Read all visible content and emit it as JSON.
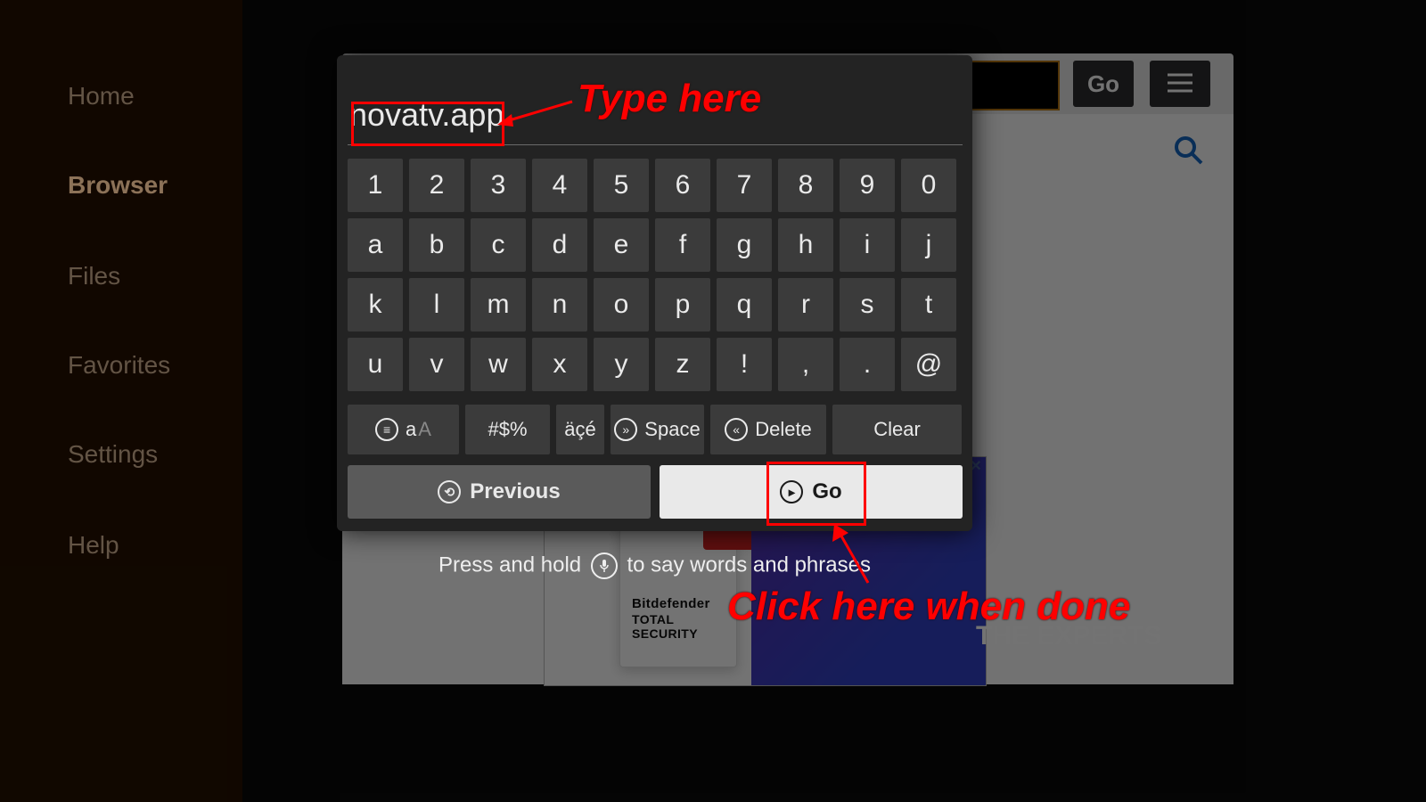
{
  "sidenav": {
    "items": [
      {
        "label": "Home"
      },
      {
        "label": "Browser"
      },
      {
        "label": "Files"
      },
      {
        "label": "Favorites"
      },
      {
        "label": "Settings"
      },
      {
        "label": "Help"
      }
    ],
    "active_index": 1
  },
  "toolbar": {
    "go_label": "Go"
  },
  "keyboard": {
    "input_value": "novatv.app",
    "rows": [
      [
        "1",
        "2",
        "3",
        "4",
        "5",
        "6",
        "7",
        "8",
        "9",
        "0"
      ],
      [
        "a",
        "b",
        "c",
        "d",
        "e",
        "f",
        "g",
        "h",
        "i",
        "j"
      ],
      [
        "k",
        "l",
        "m",
        "n",
        "o",
        "p",
        "q",
        "r",
        "s",
        "t"
      ],
      [
        "u",
        "v",
        "w",
        "x",
        "y",
        "z",
        "!",
        ",",
        ".",
        "@"
      ]
    ],
    "func": {
      "caps_small": "a",
      "caps_big": "A",
      "symbols": "#$%",
      "accents": "äçé",
      "space": "Space",
      "delete": "Delete",
      "clear": "Clear"
    },
    "previous_label": "Previous",
    "go_label": "Go"
  },
  "hint": {
    "pre": "Press and hold ",
    "post": " to say words and phrases"
  },
  "annotations": {
    "type_here": "Type here",
    "click_done": "Click here when done"
  },
  "ad": {
    "brand1": "Bitdefender",
    "brand2": "TOTAL",
    "brand3": "SECURITY",
    "headline": "THE EXPERTS"
  }
}
